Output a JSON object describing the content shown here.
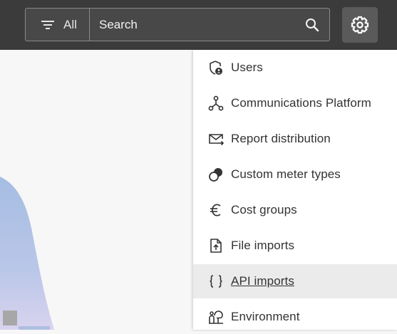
{
  "header": {
    "filter_label": "All",
    "search_placeholder": "Search"
  },
  "settings_menu": {
    "items": [
      {
        "label": "Users",
        "icon": "shield-user-icon"
      },
      {
        "label": "Communications Platform",
        "icon": "network-nodes-icon"
      },
      {
        "label": "Report distribution",
        "icon": "mail-forward-icon"
      },
      {
        "label": "Custom meter types",
        "icon": "meter-circles-icon"
      },
      {
        "label": "Cost groups",
        "icon": "euro-icon"
      },
      {
        "label": "File imports",
        "icon": "file-upload-icon"
      },
      {
        "label": "API imports",
        "icon": "curly-braces-icon",
        "active": true
      },
      {
        "label": "Environment",
        "icon": "environment-icon"
      }
    ]
  },
  "colors": {
    "topbar": "#3b3b3b",
    "menu_bg": "#ffffff",
    "active_item_bg": "#ebebeb",
    "text": "#333333"
  }
}
